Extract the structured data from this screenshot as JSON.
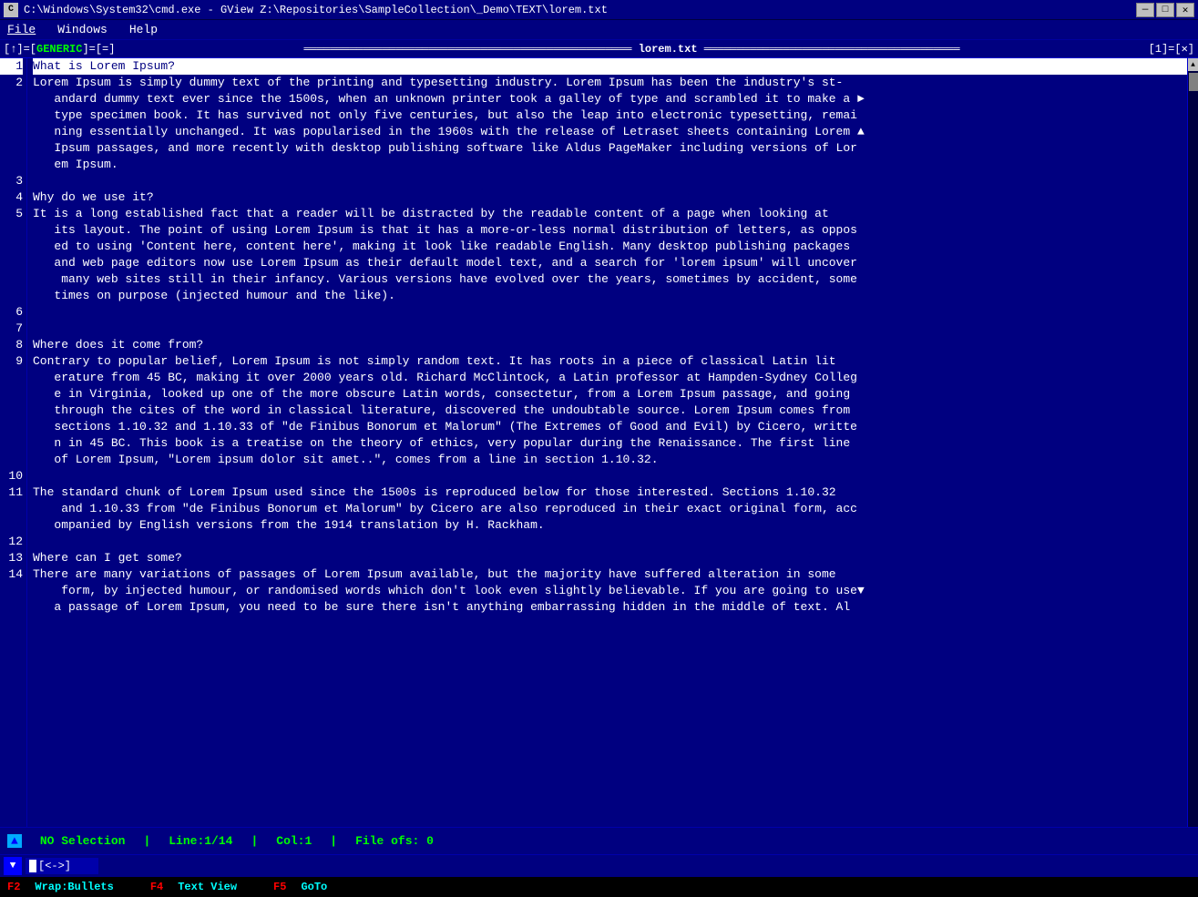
{
  "titlebar": {
    "icon": "C",
    "text": "C:\\Windows\\System32\\cmd.exe - GView  Z:\\Repositories\\SampleCollection\\_Demo\\TEXT\\lorem.txt",
    "minimize": "—",
    "maximize": "□",
    "close": "✕"
  },
  "menubar": {
    "items": [
      "File",
      "Windows",
      "Help"
    ]
  },
  "tabbar": {
    "left": "[↑]=[",
    "generic": "GENERIC",
    "middle": "]=[=]",
    "separator": "═══════════════════════════════════════════════════",
    "filename": "lorem.txt",
    "separator2": "═══════════════════════════════════════",
    "right": "[1]=[✕]"
  },
  "lines": [
    {
      "num": "1",
      "text": "What is Lorem Ipsum?",
      "selected": true
    },
    {
      "num": "2",
      "text": "Lorem Ipsum is simply dummy text of the printing and typesetting industry. Lorem Ipsum has been the industry's st-\n   andard dummy text ever since the 1500s, when an unknown printer took a galley of type and scrambled it to make a\n   type specimen book. It has survived not only five centuries, but also the leap into electronic typesetting, remai\n   ning essentially unchanged. It was popularised in the 1960s with the release of Letraset sheets containing Lorem\n   Ipsum passages, and more recently with desktop publishing software like Aldus PageMaker including versions of Lor\n   em Ipsum."
    },
    {
      "num": "3",
      "text": ""
    },
    {
      "num": "4",
      "text": "Why do we use it?"
    },
    {
      "num": "5",
      "text": "It is a long established fact that a reader will be distracted by the readable content of a page when looking at\n   its layout. The point of using Lorem Ipsum is that it has a more-or-less normal distribution of letters, as oppos\n   ed to using 'Content here, content here', making it look like readable English. Many desktop publishing packages\n   and web page editors now use Lorem Ipsum as their default model text, and a search for 'lorem ipsum' will uncover\n    many web sites still in their infancy. Various versions have evolved over the years, sometimes by accident, some\n   times on purpose (injected humour and the like)."
    },
    {
      "num": "6",
      "text": ""
    },
    {
      "num": "7",
      "text": ""
    },
    {
      "num": "8",
      "text": "Where does it come from?"
    },
    {
      "num": "9",
      "text": "Contrary to popular belief, Lorem Ipsum is not simply random text. It has roots in a piece of classical Latin lit\n   erature from 45 BC, making it over 2000 years old. Richard McClintock, a Latin professor at Hampden-Sydney Colleg\n   e in Virginia, looked up one of the more obscure Latin words, consectetur, from a Lorem Ipsum passage, and going\n   through the cites of the word in classical literature, discovered the undoubtable source. Lorem Ipsum comes from\n   sections 1.10.32 and 1.10.33 of \"de Finibus Bonorum et Malorum\" (The Extremes of Good and Evil) by Cicero, writte\n   n in 45 BC. This book is a treatise on the theory of ethics, very popular during the Renaissance. The first line\n   of Lorem Ipsum, \"Lorem ipsum dolor sit amet..\", comes from a line in section 1.10.32."
    },
    {
      "num": "10",
      "text": ""
    },
    {
      "num": "11",
      "text": "The standard chunk of Lorem Ipsum used since the 1500s is reproduced below for those interested. Sections 1.10.32\n    and 1.10.33 from \"de Finibus Bonorum et Malorum\" by Cicero are also reproduced in their exact original form, acc\n   ompanied by English versions from the 1914 translation by H. Rackham."
    },
    {
      "num": "12",
      "text": ""
    },
    {
      "num": "13",
      "text": "Where can I get some?"
    },
    {
      "num": "14",
      "text": "There are many variations of passages of Lorem Ipsum available, but the majority have suffered alteration in some\n    form, by injected humour, or randomised words which don't look even slightly believable. If you are going to use\n   a passage of Lorem Ipsum, you need to be sure there isn't anything embarrassing hidden in the middle of text. Al"
    }
  ],
  "statusbar": {
    "arrow": "▲",
    "selection": "NO Selection",
    "sep1": "|",
    "line": "Line:1/14",
    "sep2": "|",
    "col": "Col:1",
    "sep3": "|",
    "fileofs": "File ofs: 0"
  },
  "inputbar": {
    "arrow": "◄",
    "content": "[<->]"
  },
  "fkeybar": {
    "f2": "F2",
    "f2label": "Wrap:Bullets",
    "f4": "F4",
    "f4label": "Text View",
    "f5": "F5",
    "f5label": "GoTo"
  }
}
